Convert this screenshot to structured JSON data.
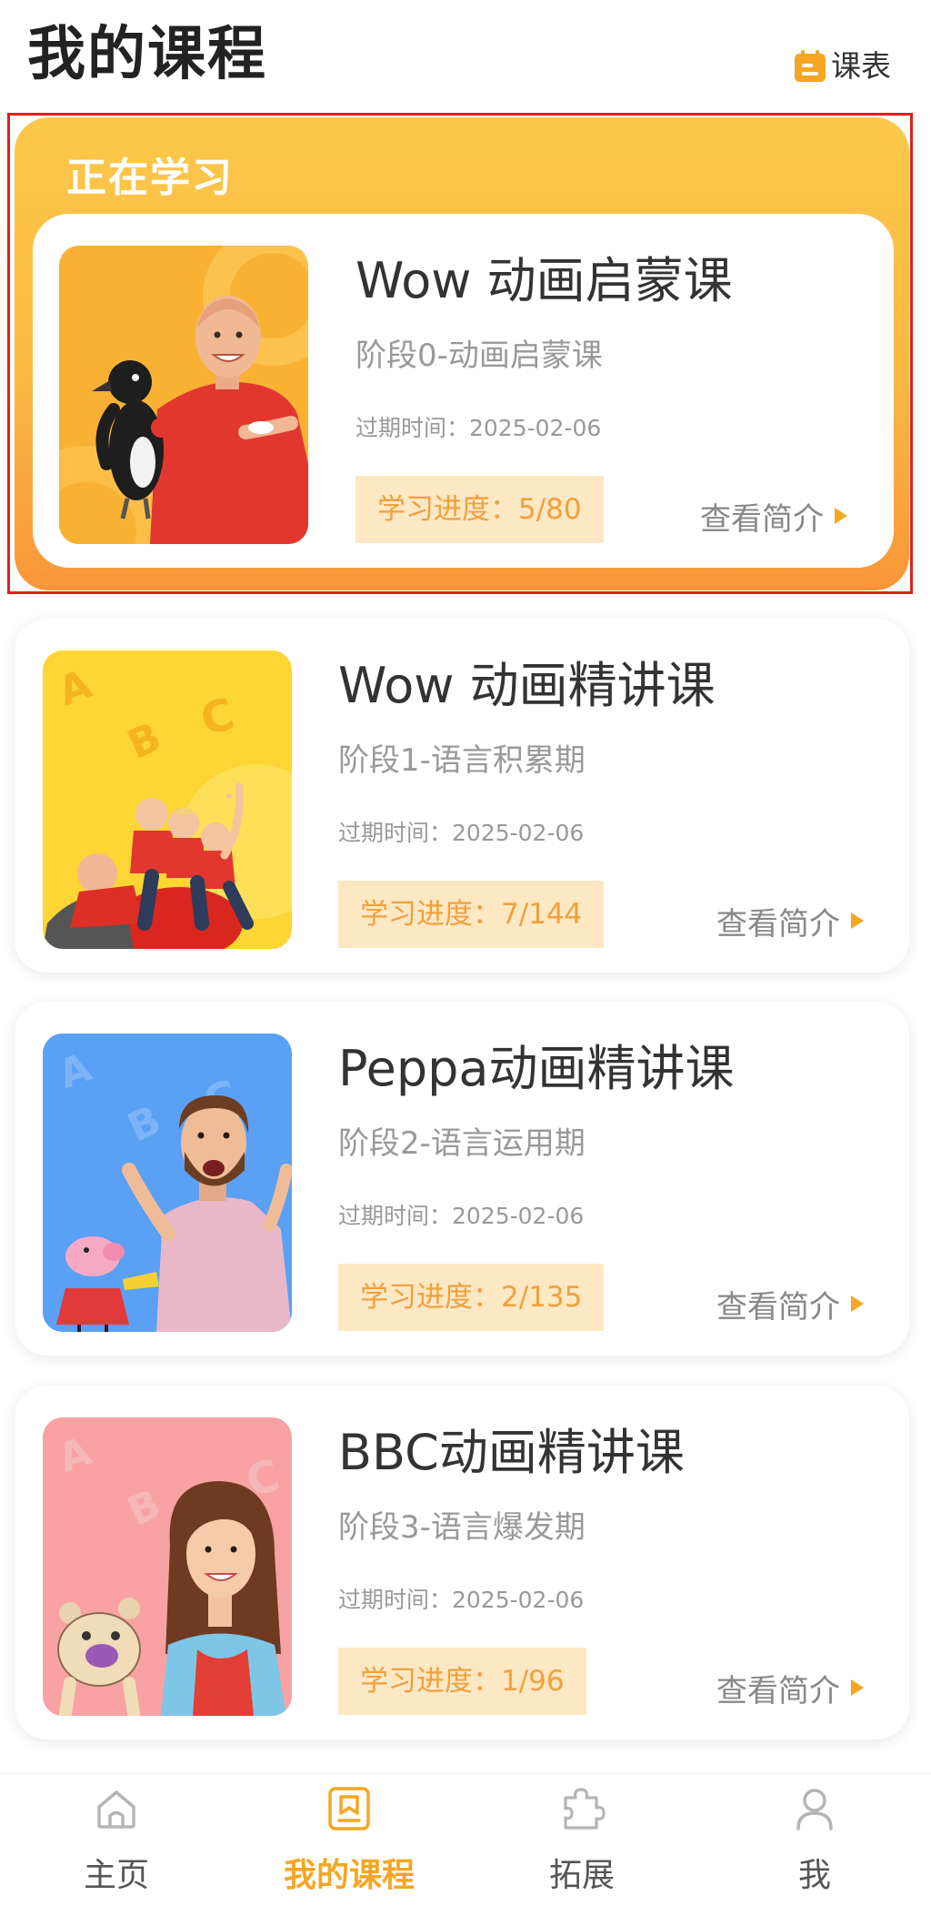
{
  "header": {
    "title": "我的课程",
    "schedule_label": "课表",
    "schedule_icon": "calendar-icon"
  },
  "current_section": {
    "label": "正在学习"
  },
  "courses": [
    {
      "title": "Wow 动画启蒙课",
      "stage": "阶段0-动画启蒙课",
      "expiry": "过期时间：2025-02-06",
      "progress": "学习进度：5/80",
      "intro_label": "查看简介"
    },
    {
      "title": "Wow 动画精讲课",
      "stage": "阶段1-语言积累期",
      "expiry": "过期时间：2025-02-06",
      "progress": "学习进度：7/144",
      "intro_label": "查看简介",
      "cover_letters": [
        "A",
        "B",
        "C"
      ]
    },
    {
      "title": "Peppa动画精讲课",
      "stage": "阶段2-语言运用期",
      "expiry": "过期时间：2025-02-06",
      "progress": "学习进度：2/135",
      "intro_label": "查看简介",
      "cover_letters": [
        "A",
        "B",
        "C"
      ]
    },
    {
      "title": "BBC动画精讲课",
      "stage": "阶段3-语言爆发期",
      "expiry": "过期时间：2025-02-06",
      "progress": "学习进度：1/96",
      "intro_label": "查看简介",
      "cover_letters": [
        "A",
        "B",
        "C"
      ]
    }
  ],
  "bottom_nav": {
    "items": [
      {
        "label": "主页",
        "icon": "home-icon",
        "active": false
      },
      {
        "label": "我的课程",
        "icon": "course-icon",
        "active": true
      },
      {
        "label": "拓展",
        "icon": "puzzle-icon",
        "active": false
      },
      {
        "label": "我",
        "icon": "person-icon",
        "active": false
      }
    ]
  },
  "theme": {
    "accent": "#f5a623",
    "title_text": "#333333",
    "muted_text": "#999999",
    "badge_bg": "#fde8c4",
    "badge_text": "#f0a03c",
    "highlight_border": "#e02020",
    "current_panel_top": "#fcc84a",
    "current_panel_bottom": "#f9963a",
    "nav_inactive": "#b5b5b5"
  }
}
